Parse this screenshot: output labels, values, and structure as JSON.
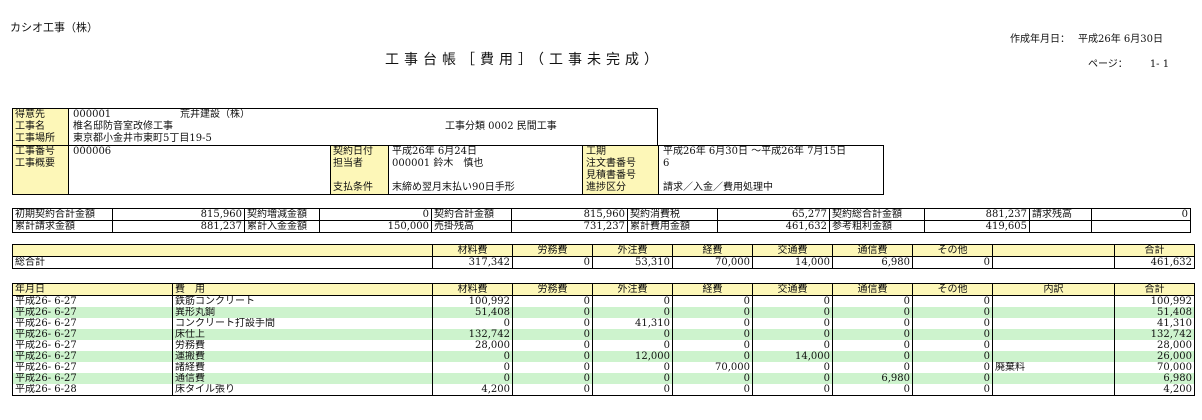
{
  "company": "カシオ工事（株）",
  "title": "工事台帳［費用］（工事未完成）",
  "created": {
    "label": "作成年月日：",
    "value": "平成26年 6月30日"
  },
  "page": {
    "label": "ページ：",
    "value": "1- 1"
  },
  "info": {
    "customer_label": "得意先",
    "customer_code": "000001",
    "customer_name": "荒井建設（株）",
    "project_name_label": "工事名",
    "project_name": "椎名邸防音室改修工事",
    "site_label": "工事場所",
    "site": "東京都小金井市東町5丁目19-5",
    "division": "工事分類 0002 民間工事",
    "project_no_label": "工事番号",
    "project_no": "000006",
    "summary_label": "工事概要",
    "contract_date_label": "契約日付",
    "contract_date": "平成26年 6月24日",
    "staff_label": "担当者",
    "staff": "000001 鈴木　慎也",
    "payment_label": "支払条件",
    "payment": "末締め翌月末払い90日手形",
    "period_label": "工期",
    "period": "平成26年 6月30日 ～平成26年 7月15日",
    "order_no_label": "注文書番号",
    "order_no": "6",
    "estimate_no_label": "見積書番号",
    "progress_label": "進捗区分",
    "progress": "請求／入金／費用処理中"
  },
  "amounts": {
    "row1": [
      {
        "label": "初期契約合計金額",
        "value": "815,960"
      },
      {
        "label": "契約増減金額",
        "value": "0"
      },
      {
        "label": "契約合計金額",
        "value": "815,960"
      },
      {
        "label": "契約消費税",
        "value": "65,277"
      },
      {
        "label": "契約総合計金額",
        "value": "881,237"
      },
      {
        "label": "請求残高",
        "value": "0"
      }
    ],
    "row2": [
      {
        "label": "累計請求金額",
        "value": "881,237"
      },
      {
        "label": "累計入金金額",
        "value": "150,000"
      },
      {
        "label": "売掛残高",
        "value": "731,237"
      },
      {
        "label": "累計費用金額",
        "value": "461,632"
      },
      {
        "label": "参考粗利金額",
        "value": "419,605"
      }
    ]
  },
  "summary": {
    "headers": [
      "材料費",
      "労務費",
      "外注費",
      "経費",
      "交通費",
      "通信費",
      "その他",
      "合計"
    ],
    "row_label": "総合計",
    "values": [
      "317,342",
      "0",
      "53,310",
      "70,000",
      "14,000",
      "6,980",
      "0",
      "461,632"
    ]
  },
  "detail": {
    "headers": [
      "年月日",
      "費　用",
      "材料費",
      "労務費",
      "外注費",
      "経費",
      "交通費",
      "通信費",
      "その他",
      "内訳",
      "合計"
    ],
    "rows": [
      {
        "date": "平成26- 6-27",
        "item": "鉄筋コンクリート",
        "vals": [
          "100,992",
          "0",
          "0",
          "0",
          "0",
          "0",
          "0"
        ],
        "note": "",
        "total": "100,992"
      },
      {
        "date": "平成26- 6-27",
        "item": "異形丸鋼",
        "vals": [
          "51,408",
          "0",
          "0",
          "0",
          "0",
          "0",
          "0"
        ],
        "note": "",
        "total": "51,408"
      },
      {
        "date": "平成26- 6-27",
        "item": "コンクリート打設手間",
        "vals": [
          "0",
          "0",
          "41,310",
          "0",
          "0",
          "0",
          "0"
        ],
        "note": "",
        "total": "41,310"
      },
      {
        "date": "平成26- 6-27",
        "item": "床仕上",
        "vals": [
          "132,742",
          "0",
          "0",
          "0",
          "0",
          "0",
          "0"
        ],
        "note": "",
        "total": "132,742"
      },
      {
        "date": "平成26- 6-27",
        "item": "労務費",
        "vals": [
          "28,000",
          "0",
          "0",
          "0",
          "0",
          "0",
          "0"
        ],
        "note": "",
        "total": "28,000"
      },
      {
        "date": "平成26- 6-27",
        "item": "運搬費",
        "vals": [
          "0",
          "0",
          "12,000",
          "0",
          "14,000",
          "0",
          "0"
        ],
        "note": "",
        "total": "26,000"
      },
      {
        "date": "平成26- 6-27",
        "item": "諸経費",
        "vals": [
          "0",
          "0",
          "0",
          "70,000",
          "0",
          "0",
          "0"
        ],
        "note": "廃棄料",
        "total": "70,000"
      },
      {
        "date": "平成26- 6-27",
        "item": "通信費",
        "vals": [
          "0",
          "0",
          "0",
          "0",
          "0",
          "6,980",
          "0"
        ],
        "note": "",
        "total": "6,980"
      },
      {
        "date": "平成26- 6-28",
        "item": "床タイル張り",
        "vals": [
          "4,200",
          "0",
          "0",
          "0",
          "0",
          "0",
          "0"
        ],
        "note": "",
        "total": "4,200"
      }
    ]
  },
  "colors": {
    "label_bg": "#fdf7b8",
    "stripe_bg": "#cdf3cd"
  }
}
